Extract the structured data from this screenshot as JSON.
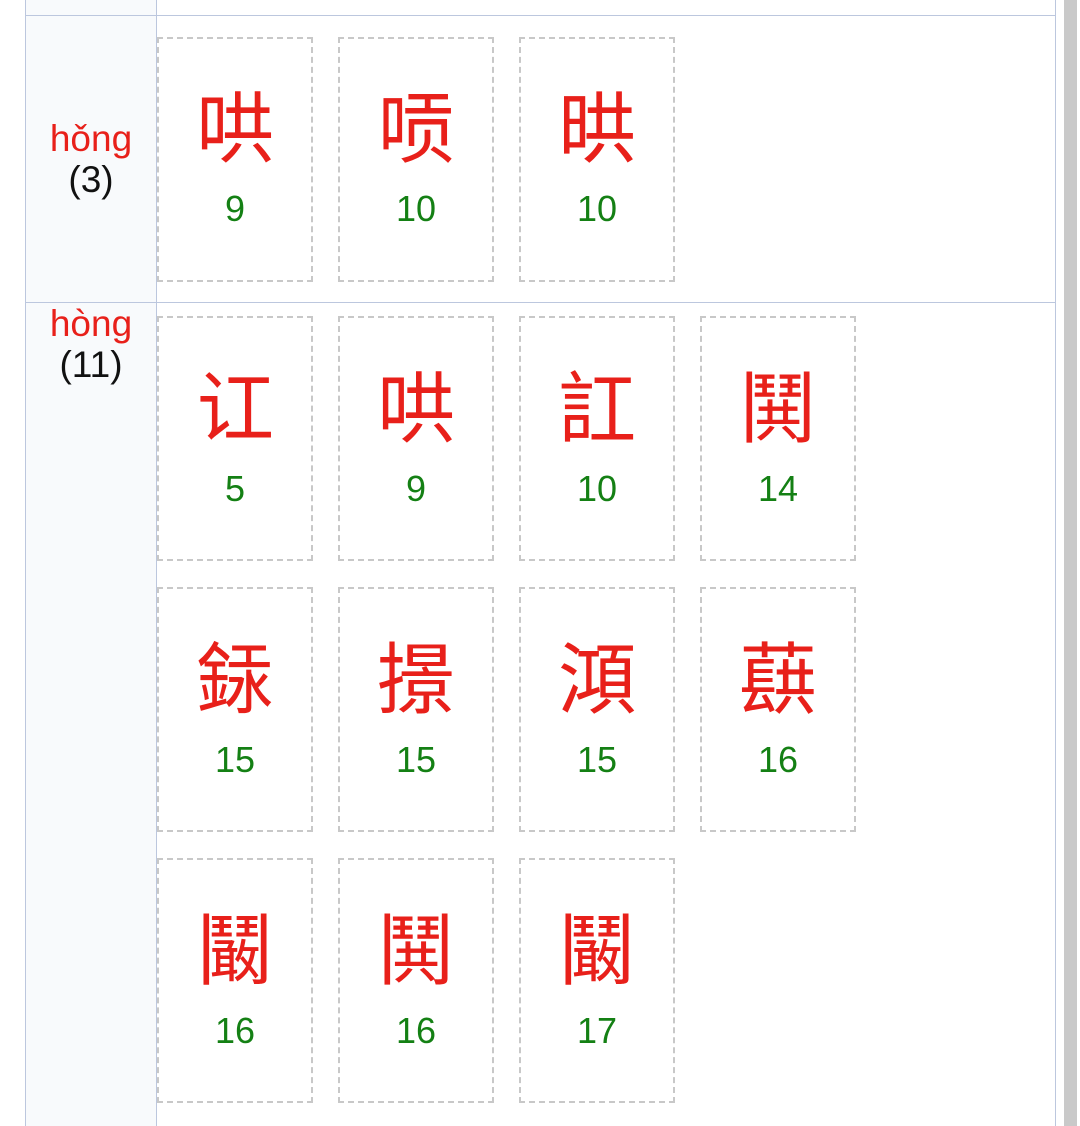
{
  "page": {
    "type": "chinese-character-reference-table",
    "scrollbar": {
      "name": "vertical-scrollbar",
      "color": "#c9c9c9"
    }
  },
  "colors": {
    "pinyin": "#e8201a",
    "character": "#e8201a",
    "stroke_count": "#148014",
    "count_text": "#111111",
    "table_border": "#bcc7de",
    "char_box_border": "#c8c8c8",
    "pinyin_cell_bg": "#f8fafc"
  },
  "rows": [
    {
      "pinyin": "hǒng",
      "count": "(3)",
      "characters": [
        {
          "glyph": "哄",
          "strokes": "9"
        },
        {
          "glyph": "唝",
          "strokes": "10"
        },
        {
          "glyph": "晎",
          "strokes": "10"
        }
      ]
    },
    {
      "pinyin": "hòng",
      "count": "(11)",
      "characters": [
        {
          "glyph": "讧",
          "strokes": "5"
        },
        {
          "glyph": "哄",
          "strokes": "9"
        },
        {
          "glyph": "訌",
          "strokes": "10"
        },
        {
          "glyph": "鬨",
          "strokes": "14"
        },
        {
          "glyph": "銾",
          "strokes": "15"
        },
        {
          "glyph": "撔",
          "strokes": "15"
        },
        {
          "glyph": "澒",
          "strokes": "15"
        },
        {
          "glyph": "蕻",
          "strokes": "16"
        },
        {
          "glyph": "鬫",
          "strokes": "16"
        },
        {
          "glyph": "鬨",
          "strokes": "16"
        },
        {
          "glyph": "鬫",
          "strokes": "17"
        }
      ]
    }
  ]
}
